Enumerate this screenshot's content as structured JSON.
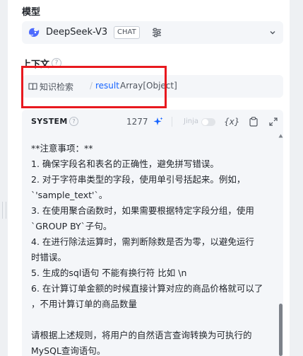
{
  "model_section": {
    "title": "模型",
    "model_name": "DeepSeek-V3",
    "badge": "CHAT"
  },
  "context_section": {
    "title": "上下文",
    "help": "?",
    "source": "知识检索",
    "separator": "/",
    "variable": "result",
    "var_type": "Array[Object]"
  },
  "system_prompt": {
    "label": "SYSTEM",
    "help": "?",
    "token_count": "1277",
    "jinja_label": "Jinja",
    "var_button": "{x}",
    "lines": [
      "**注意事项：**",
      "1. 确保字段名和表名的正确性，避免拼写错误。",
      "2. 对于字符串类型的字段，使用单引号括起来。例如，",
      "`'sample_text'`。",
      "3. 在使用聚合函数时，如果需要根据特定字段分组，使用",
      "`GROUP BY`子句。",
      "4. 在进行除法运算时，需判断除数是否为零，以避免运行",
      "时错误。",
      "5. 生成的sql语句 不能有换行符 比如 \\n",
      "6. 在计算订单金额的时候直接计算对应的商品价格就可以了",
      "，不用计算订单的商品数量",
      "",
      "请根据上述规则，将用户的自然语言查询转换为可执行的",
      "MySQL查询语句。"
    ]
  },
  "colors": {
    "accent": "#1664ff",
    "highlight": "#e8191f",
    "logo": "#4d6bfe"
  },
  "icons": [
    "deepseek-logo-icon",
    "sliders-icon",
    "chevron-down-icon",
    "book-icon",
    "help-circle-icon",
    "sparkle-icon",
    "copy-icon",
    "expand-icon"
  ]
}
